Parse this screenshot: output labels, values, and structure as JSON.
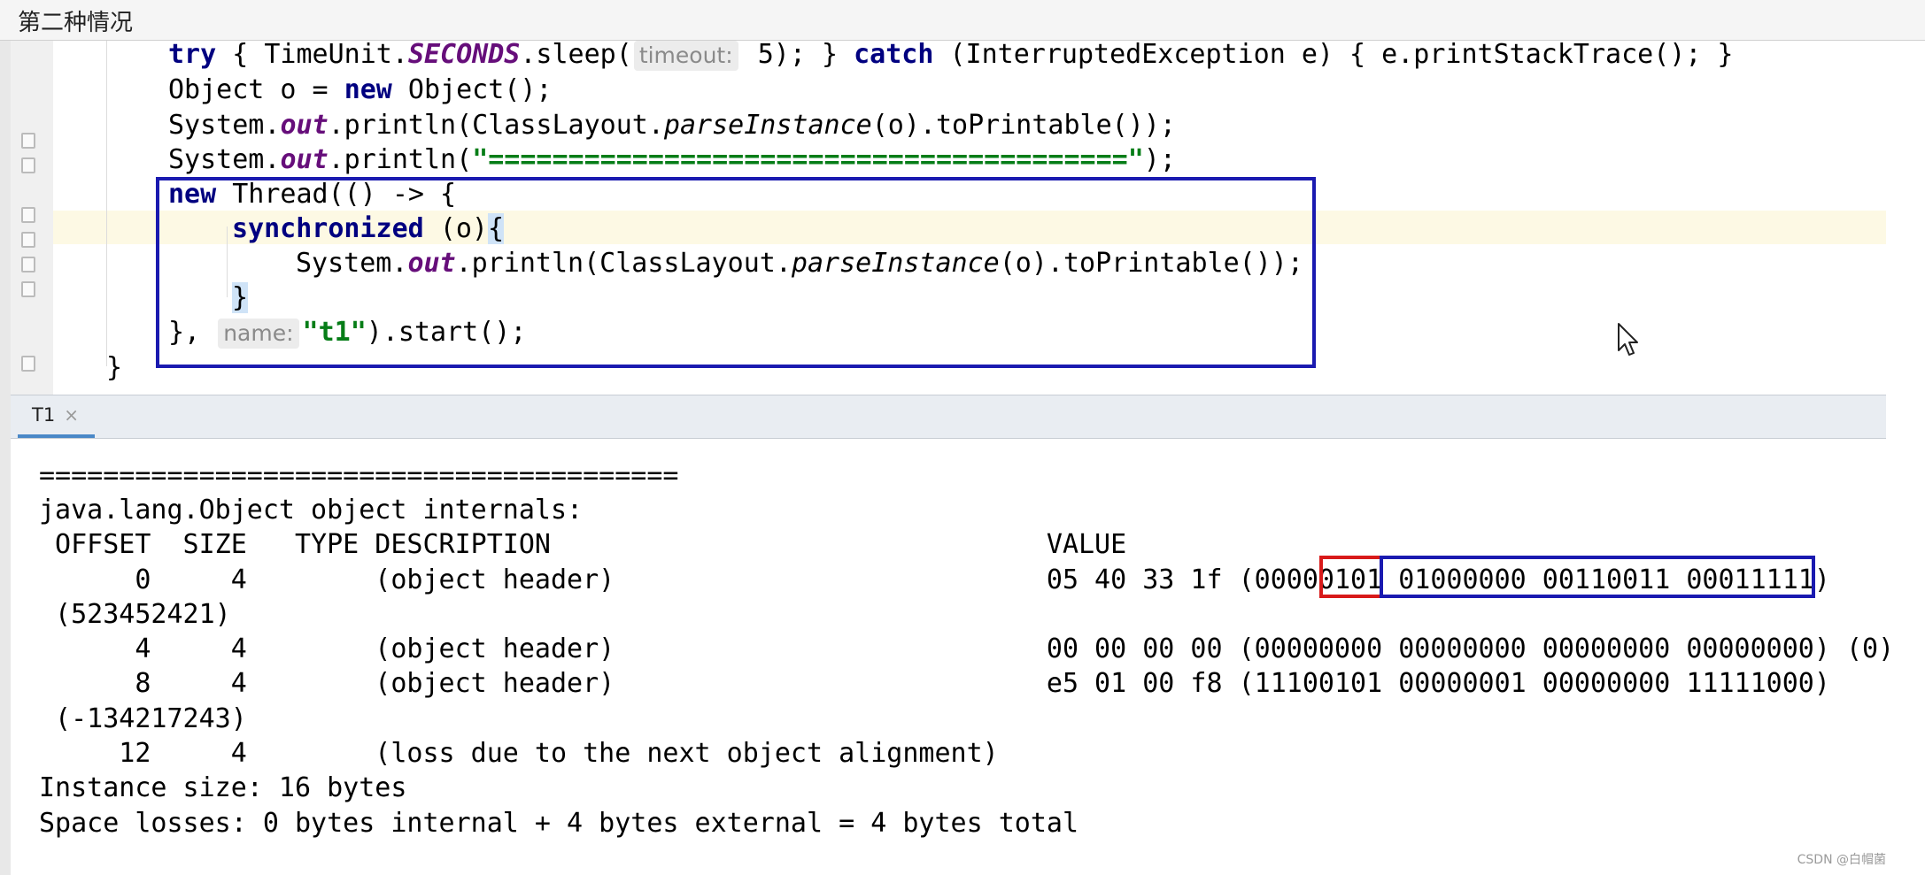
{
  "header": {
    "title": "第二种情况"
  },
  "editor": {
    "line1": {
      "try": "try",
      "open": " { TimeUnit.",
      "seconds": "SECONDS",
      "sleep": ".sleep(",
      "hint": "timeout:",
      "arg": " 5); } ",
      "catch": "catch",
      "rest": " (InterruptedException e) { e.printStackTrace(); }"
    },
    "line2": {
      "decl": "Object o = ",
      "new": "new",
      "ctor": " Object();"
    },
    "line3": {
      "sys": "System.",
      "out": "out",
      "print": ".println(ClassLayout.",
      "parse": "parseInstance",
      "rest": "(o).toPrintable());"
    },
    "line4": {
      "sys": "System.",
      "out": "out",
      "print": ".println(",
      "str": "\"========================================\"",
      "close": ");"
    },
    "line5": {
      "new": "new",
      "rest": " Thread(() -> {"
    },
    "line6": {
      "sync": "synchronized",
      "arg": " (o)",
      "brace": "{"
    },
    "line7": {
      "sys": "System.",
      "out": "out",
      "print": ".println(ClassLayout.",
      "parse": "parseInstance",
      "rest": "(o).toPrintable());"
    },
    "line8": {
      "brace": "}"
    },
    "line9": {
      "open": "}, ",
      "hint": "name:",
      "str": "\"t1\"",
      "rest": ").start();"
    },
    "line10": {
      "text": "}"
    }
  },
  "tab": {
    "label": "T1",
    "close": "×"
  },
  "console": {
    "lines": [
      "========================================",
      "java.lang.Object object internals:",
      " OFFSET  SIZE   TYPE DESCRIPTION                               VALUE",
      "      0     4        (object header)                           05 40 33 1f (00000101 01000000 00110011 00011111)",
      " (523452421)",
      "      4     4        (object header)                           00 00 00 00 (00000000 00000000 00000000 00000000) (0)",
      "      8     4        (object header)                           e5 01 00 f8 (11100101 00000001 00000000 11111000)",
      " (-134217243)",
      "     12     4        (loss due to the next object alignment)",
      "Instance size: 16 bytes",
      "Space losses: 0 bytes internal + 4 bytes external = 4 bytes total"
    ]
  },
  "colors": {
    "keyword": "#000080",
    "field": "#660e7a",
    "string": "#067d17",
    "blue_box": "#1a1ab0",
    "red_box": "#d81a1a"
  },
  "icons": {
    "cursor": "mouse-pointer-icon",
    "fold": "fold-marker-icon",
    "close": "close-icon"
  },
  "watermark": "CSDN @白帽菌"
}
